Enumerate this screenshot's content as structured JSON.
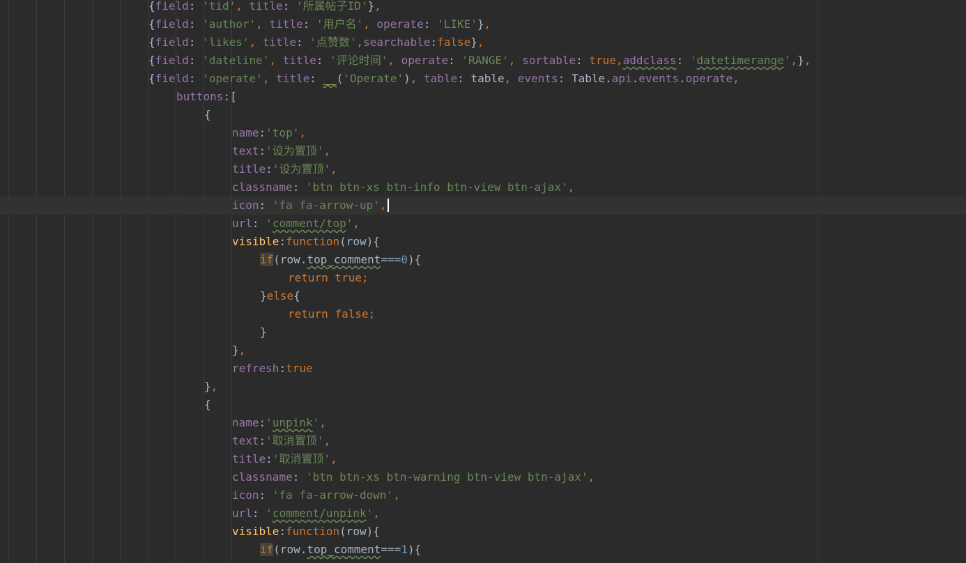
{
  "editor": {
    "colors": {
      "background": "#2b2b2b",
      "default_text": "#a9b7c6",
      "property": "#9876aa",
      "string": "#6a8759",
      "keyword": "#cc7832",
      "number": "#6897bb",
      "function_name": "#ffc66d",
      "current_line": "#323232"
    },
    "current_line_index": 11,
    "lines": [
      {
        "indent": 5,
        "tokens": [
          {
            "c": "t",
            "v": "{"
          },
          {
            "c": "p",
            "v": "field"
          },
          {
            "c": "t",
            "v": ": "
          },
          {
            "c": "s",
            "v": "'tid'"
          },
          {
            "c": "k",
            "v": ", "
          },
          {
            "c": "p",
            "v": "title"
          },
          {
            "c": "t",
            "v": ": "
          },
          {
            "c": "s",
            "v": "'所属帖子ID'"
          },
          {
            "c": "t",
            "v": "}"
          },
          {
            "c": "k",
            "v": ","
          }
        ]
      },
      {
        "indent": 5,
        "tokens": [
          {
            "c": "t",
            "v": "{"
          },
          {
            "c": "p",
            "v": "field"
          },
          {
            "c": "t",
            "v": ": "
          },
          {
            "c": "s",
            "v": "'author'"
          },
          {
            "c": "k",
            "v": ", "
          },
          {
            "c": "p",
            "v": "title"
          },
          {
            "c": "t",
            "v": ": "
          },
          {
            "c": "s",
            "v": "'用户名'"
          },
          {
            "c": "k",
            "v": ", "
          },
          {
            "c": "p",
            "v": "operate"
          },
          {
            "c": "t",
            "v": ": "
          },
          {
            "c": "s",
            "v": "'LIKE'"
          },
          {
            "c": "t",
            "v": "}"
          },
          {
            "c": "k",
            "v": ","
          }
        ]
      },
      {
        "indent": 5,
        "tokens": [
          {
            "c": "t",
            "v": "{"
          },
          {
            "c": "p",
            "v": "field"
          },
          {
            "c": "t",
            "v": ": "
          },
          {
            "c": "s",
            "v": "'likes'"
          },
          {
            "c": "k",
            "v": ", "
          },
          {
            "c": "p",
            "v": "title"
          },
          {
            "c": "t",
            "v": ": "
          },
          {
            "c": "s",
            "v": "'点赞数'"
          },
          {
            "c": "k",
            "v": ","
          },
          {
            "c": "p",
            "v": "searchable"
          },
          {
            "c": "t",
            "v": ":"
          },
          {
            "c": "k",
            "v": "false"
          },
          {
            "c": "t",
            "v": "}"
          },
          {
            "c": "k",
            "v": ","
          }
        ]
      },
      {
        "indent": 5,
        "tokens": [
          {
            "c": "t",
            "v": "{"
          },
          {
            "c": "p",
            "v": "field"
          },
          {
            "c": "t",
            "v": ": "
          },
          {
            "c": "s",
            "v": "'dateline'"
          },
          {
            "c": "k",
            "v": ", "
          },
          {
            "c": "p",
            "v": "title"
          },
          {
            "c": "t",
            "v": ": "
          },
          {
            "c": "s",
            "v": "'评论时间'"
          },
          {
            "c": "k",
            "v": ", "
          },
          {
            "c": "p",
            "v": "operate"
          },
          {
            "c": "t",
            "v": ": "
          },
          {
            "c": "s",
            "v": "'RANGE'"
          },
          {
            "c": "k",
            "v": ", "
          },
          {
            "c": "p",
            "v": "sortable"
          },
          {
            "c": "t",
            "v": ": "
          },
          {
            "c": "k",
            "v": "true,"
          },
          {
            "c": "p u",
            "v": "addclass"
          },
          {
            "c": "t",
            "v": ": "
          },
          {
            "c": "s",
            "v": "'"
          },
          {
            "c": "s u",
            "v": "datetimerange"
          },
          {
            "c": "s",
            "v": "'"
          },
          {
            "c": "k",
            "v": ","
          },
          {
            "c": "t",
            "v": "}"
          },
          {
            "c": "k",
            "v": ","
          }
        ]
      },
      {
        "indent": 5,
        "tokens": [
          {
            "c": "t",
            "v": "{"
          },
          {
            "c": "p",
            "v": "field"
          },
          {
            "c": "t",
            "v": ": "
          },
          {
            "c": "s",
            "v": "'operate'"
          },
          {
            "c": "k",
            "v": ", "
          },
          {
            "c": "p",
            "v": "title"
          },
          {
            "c": "t",
            "v": ": "
          },
          {
            "c": "f u",
            "v": "__"
          },
          {
            "c": "t",
            "v": "("
          },
          {
            "c": "s",
            "v": "'Operate'"
          },
          {
            "c": "t",
            "v": ")"
          },
          {
            "c": "k",
            "v": ", "
          },
          {
            "c": "p",
            "v": "table"
          },
          {
            "c": "t",
            "v": ": table"
          },
          {
            "c": "k",
            "v": ", "
          },
          {
            "c": "p",
            "v": "events"
          },
          {
            "c": "t",
            "v": ": Table."
          },
          {
            "c": "p",
            "v": "api"
          },
          {
            "c": "t",
            "v": "."
          },
          {
            "c": "p",
            "v": "events"
          },
          {
            "c": "t",
            "v": "."
          },
          {
            "c": "p",
            "v": "operate"
          },
          {
            "c": "k",
            "v": ","
          }
        ]
      },
      {
        "indent": 6,
        "tokens": [
          {
            "c": "p",
            "v": "buttons"
          },
          {
            "c": "t",
            "v": ":["
          }
        ]
      },
      {
        "indent": 7,
        "tokens": [
          {
            "c": "t",
            "v": "{"
          }
        ]
      },
      {
        "indent": 8,
        "tokens": [
          {
            "c": "p",
            "v": "name"
          },
          {
            "c": "t",
            "v": ":"
          },
          {
            "c": "s",
            "v": "'top'"
          },
          {
            "c": "k",
            "v": ","
          }
        ]
      },
      {
        "indent": 8,
        "tokens": [
          {
            "c": "p",
            "v": "text"
          },
          {
            "c": "t",
            "v": ":"
          },
          {
            "c": "s",
            "v": "'设为置顶'"
          },
          {
            "c": "k",
            "v": ","
          }
        ]
      },
      {
        "indent": 8,
        "tokens": [
          {
            "c": "p",
            "v": "title"
          },
          {
            "c": "t",
            "v": ":"
          },
          {
            "c": "s",
            "v": "'设为置顶'"
          },
          {
            "c": "k",
            "v": ","
          }
        ]
      },
      {
        "indent": 8,
        "tokens": [
          {
            "c": "p",
            "v": "classname"
          },
          {
            "c": "t",
            "v": ": "
          },
          {
            "c": "s",
            "v": "'btn btn-xs btn-info btn-view btn-ajax'"
          },
          {
            "c": "k",
            "v": ","
          }
        ]
      },
      {
        "indent": 8,
        "tokens": [
          {
            "c": "p",
            "v": "icon"
          },
          {
            "c": "t",
            "v": ": "
          },
          {
            "c": "s",
            "v": "'fa fa-arrow-up'"
          },
          {
            "c": "k",
            "v": ","
          }
        ]
      },
      {
        "indent": 8,
        "tokens": [
          {
            "c": "p",
            "v": "url"
          },
          {
            "c": "t",
            "v": ": "
          },
          {
            "c": "s",
            "v": "'"
          },
          {
            "c": "s u",
            "v": "comment/top"
          },
          {
            "c": "s",
            "v": "'"
          },
          {
            "c": "k",
            "v": ","
          }
        ]
      },
      {
        "indent": 8,
        "tokens": [
          {
            "c": "f",
            "v": "visible"
          },
          {
            "c": "t",
            "v": ":"
          },
          {
            "c": "k",
            "v": "function"
          },
          {
            "c": "t",
            "v": "(row){"
          }
        ]
      },
      {
        "indent": 9,
        "tokens": [
          {
            "c": "k hl",
            "v": "if"
          },
          {
            "c": "t",
            "v": "(row."
          },
          {
            "c": "t u",
            "v": "top_comment"
          },
          {
            "c": "t",
            "v": "==="
          },
          {
            "c": "n",
            "v": "0"
          },
          {
            "c": "t",
            "v": "){"
          }
        ]
      },
      {
        "indent": 10,
        "tokens": [
          {
            "c": "k",
            "v": "return true;"
          }
        ]
      },
      {
        "indent": 9,
        "tokens": [
          {
            "c": "t",
            "v": "}"
          },
          {
            "c": "k",
            "v": "else"
          },
          {
            "c": "t",
            "v": "{"
          }
        ]
      },
      {
        "indent": 10,
        "tokens": [
          {
            "c": "k",
            "v": "return false;"
          }
        ]
      },
      {
        "indent": 9,
        "tokens": [
          {
            "c": "t",
            "v": "}"
          }
        ]
      },
      {
        "indent": 8,
        "tokens": [
          {
            "c": "t",
            "v": "}"
          },
          {
            "c": "k",
            "v": ","
          }
        ]
      },
      {
        "indent": 8,
        "tokens": [
          {
            "c": "p",
            "v": "refresh"
          },
          {
            "c": "t",
            "v": ":"
          },
          {
            "c": "k",
            "v": "true"
          }
        ]
      },
      {
        "indent": 7,
        "tokens": [
          {
            "c": "t",
            "v": "}"
          },
          {
            "c": "k",
            "v": ","
          }
        ]
      },
      {
        "indent": 7,
        "tokens": [
          {
            "c": "t",
            "v": "{"
          }
        ]
      },
      {
        "indent": 8,
        "tokens": [
          {
            "c": "p",
            "v": "name"
          },
          {
            "c": "t",
            "v": ":"
          },
          {
            "c": "s",
            "v": "'"
          },
          {
            "c": "s u",
            "v": "unpink"
          },
          {
            "c": "s",
            "v": "'"
          },
          {
            "c": "k",
            "v": ","
          }
        ]
      },
      {
        "indent": 8,
        "tokens": [
          {
            "c": "p",
            "v": "text"
          },
          {
            "c": "t",
            "v": ":"
          },
          {
            "c": "s",
            "v": "'取消置顶'"
          },
          {
            "c": "k",
            "v": ","
          }
        ]
      },
      {
        "indent": 8,
        "tokens": [
          {
            "c": "p",
            "v": "title"
          },
          {
            "c": "t",
            "v": ":"
          },
          {
            "c": "s",
            "v": "'取消置顶'"
          },
          {
            "c": "k",
            "v": ","
          }
        ]
      },
      {
        "indent": 8,
        "tokens": [
          {
            "c": "p",
            "v": "classname"
          },
          {
            "c": "t",
            "v": ": "
          },
          {
            "c": "s",
            "v": "'btn btn-xs btn-warning btn-view btn-ajax'"
          },
          {
            "c": "k",
            "v": ","
          }
        ]
      },
      {
        "indent": 8,
        "tokens": [
          {
            "c": "p",
            "v": "icon"
          },
          {
            "c": "t",
            "v": ": "
          },
          {
            "c": "s",
            "v": "'fa fa-arrow-down'"
          },
          {
            "c": "k",
            "v": ","
          }
        ]
      },
      {
        "indent": 8,
        "tokens": [
          {
            "c": "p",
            "v": "url"
          },
          {
            "c": "t",
            "v": ": "
          },
          {
            "c": "s",
            "v": "'"
          },
          {
            "c": "s u",
            "v": "comment/unpink"
          },
          {
            "c": "s",
            "v": "'"
          },
          {
            "c": "k",
            "v": ","
          }
        ]
      },
      {
        "indent": 8,
        "tokens": [
          {
            "c": "f",
            "v": "visible"
          },
          {
            "c": "t",
            "v": ":"
          },
          {
            "c": "k",
            "v": "function"
          },
          {
            "c": "t",
            "v": "(row){"
          }
        ]
      },
      {
        "indent": 9,
        "tokens": [
          {
            "c": "k hl",
            "v": "if"
          },
          {
            "c": "t",
            "v": "(row."
          },
          {
            "c": "t u",
            "v": "top_comment"
          },
          {
            "c": "t",
            "v": "==="
          },
          {
            "c": "n",
            "v": "1"
          },
          {
            "c": "t",
            "v": "){"
          }
        ]
      }
    ]
  }
}
